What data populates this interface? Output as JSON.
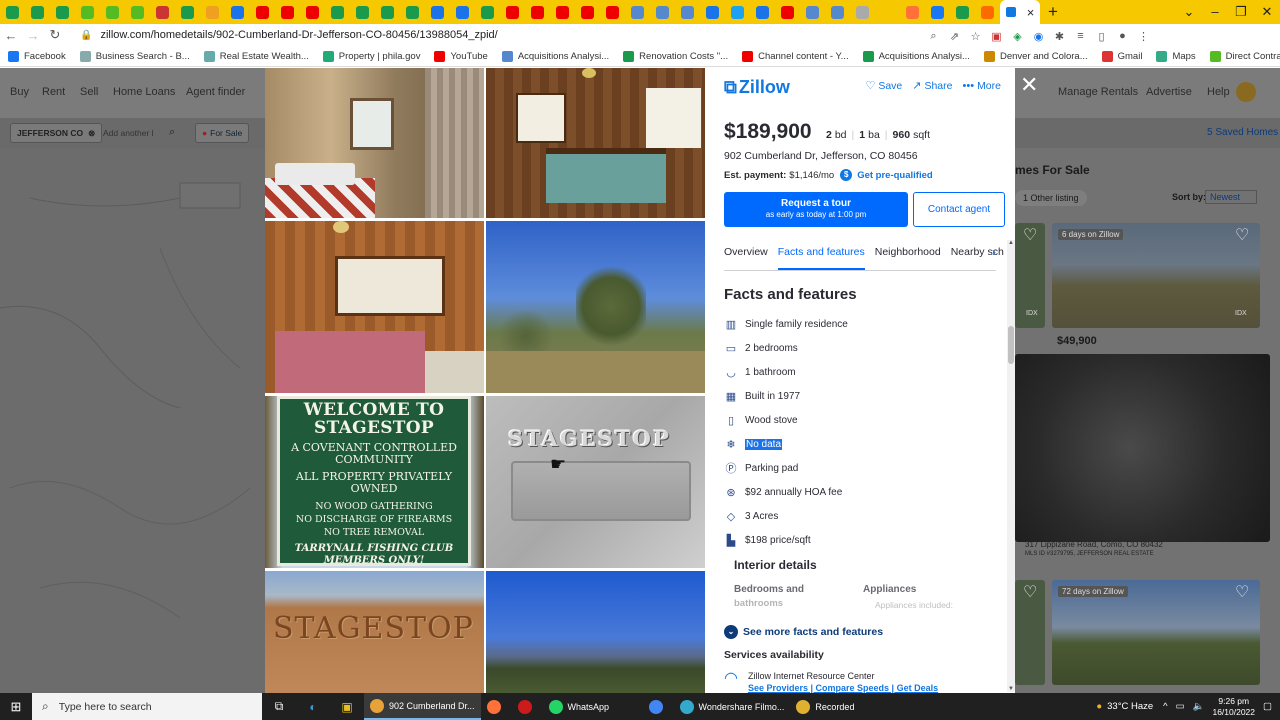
{
  "browser": {
    "url": "zillow.com/homedetails/902-Cumberland-Dr-Jefferson-CO-80456/13988054_zpid/",
    "tab_close": "×",
    "new_tab": "+",
    "bookmarks": [
      {
        "label": "Facebook",
        "color": "#1877f2"
      },
      {
        "label": "Business Search - B...",
        "color": "#8aa"
      },
      {
        "label": "Real Estate Wealth...",
        "color": "#6aa"
      },
      {
        "label": "Property | phila.gov",
        "color": "#2a7"
      },
      {
        "label": "YouTube",
        "color": "#e00"
      },
      {
        "label": "Acquisitions Analysi...",
        "color": "#58c"
      },
      {
        "label": "Renovation Costs \"...",
        "color": "#1a9a4a"
      },
      {
        "label": "Channel content - Y...",
        "color": "#e00"
      },
      {
        "label": "Acquisitions Analysi...",
        "color": "#1a9a4a"
      },
      {
        "label": "Denver and Colora...",
        "color": "#c80"
      },
      {
        "label": "Gmail",
        "color": "#d33"
      },
      {
        "label": "Maps",
        "color": "#3a8"
      },
      {
        "label": "Direct Contracts - U...",
        "color": "#5b2"
      }
    ]
  },
  "background": {
    "nav": [
      "Buy",
      "Rent",
      "Sell",
      "Home Loans",
      "Agent finder",
      "Manage Rentals",
      "Advertise",
      "Help"
    ],
    "search_chip": "JEFFERSON CO",
    "search_placeholder": "Add another l",
    "for_sale_chip": "For Sale",
    "saved_homes": "5 Saved Homes",
    "homes_for_sale": "mes For Sale",
    "other_listing": "1 Other listing",
    "sort_label": "Sort by:",
    "sort_value": "Newest",
    "days_badge_1": "6 days on Zillow",
    "price_card": "$49,900",
    "card_address": "317 Lippizane Road, Como, CO 80432",
    "card_mls": "MLS ID #3279795, JEFFERSON REAL ESTATE",
    "days_badge_2": "72 days on Zillow",
    "idx": "IDX"
  },
  "photos": {
    "sign_line1": "WELCOME TO",
    "sign_line2": "STAGESTOP",
    "sign_line3": "A COVENANT CONTROLLED COMMUNITY",
    "sign_line4": "ALL PROPERTY PRIVATELY OWNED",
    "sign_rule1": "NO WOOD GATHERING",
    "sign_rule2": "NO DISCHARGE OF FIREARMS",
    "sign_rule3": "NO TREE REMOVAL",
    "sign_club": "TARRYNALL FISHING CLUB MEMBERS ONLY!",
    "plaque": "STAGESTOP",
    "wood_sign": "STAGESTOP"
  },
  "listing": {
    "brand": "Zillow",
    "save": "Save",
    "share": "Share",
    "more": "More",
    "price": "$189,900",
    "beds_n": "2",
    "beds_l": "bd",
    "baths_n": "1",
    "baths_l": "ba",
    "sqft_n": "960",
    "sqft_l": "sqft",
    "address": "902 Cumberland Dr, Jefferson, CO 80456",
    "est_payment_label": "Est. payment:",
    "est_payment_value": "$1,146/mo",
    "pre_qualified": "Get pre-qualified",
    "tour_main": "Request a tour",
    "tour_sub": "as early as today at 1:00 pm",
    "contact_agent": "Contact agent",
    "tabs": [
      "Overview",
      "Facts and features",
      "Neighborhood",
      "Nearby sch"
    ],
    "facts_title": "Facts and features",
    "facts": [
      {
        "icon": "building-icon",
        "glyph": "▥",
        "label": "Single family residence"
      },
      {
        "icon": "bed-icon",
        "glyph": "▭",
        "label": "2 bedrooms"
      },
      {
        "icon": "bath-icon",
        "glyph": "◡",
        "label": "1 bathroom"
      },
      {
        "icon": "calendar-icon",
        "glyph": "▦",
        "label": "Built in 1977"
      },
      {
        "icon": "thermometer-icon",
        "glyph": "▯",
        "label": "Wood stove"
      },
      {
        "icon": "snowflake-icon",
        "glyph": "❄",
        "label": "No data"
      },
      {
        "icon": "parking-icon",
        "glyph": "Ⓟ",
        "label": "Parking pad"
      },
      {
        "icon": "hoa-icon",
        "glyph": "⊛",
        "label": "$92 annually HOA fee"
      },
      {
        "icon": "lot-icon",
        "glyph": "◇",
        "label": "3 Acres"
      },
      {
        "icon": "price-sqft-icon",
        "glyph": "▙",
        "label": "$198 price/sqft"
      }
    ],
    "interior_title": "Interior details",
    "bed_bath_head": "Bedrooms and",
    "bed_bath_head2": "bathrooms",
    "appliances_head": "Appliances",
    "appliances_sub": "Appliances included:",
    "see_more": "See more facts and features",
    "services_title": "Services availability",
    "service_name": "Zillow Internet Resource Center",
    "service_links": "See Providers | Compare Speeds | Get Deals"
  },
  "taskbar": {
    "search_placeholder": "Type here to search",
    "apps": [
      {
        "label": "902 Cumberland Dr...",
        "color": "#e8a23a",
        "active": true
      },
      {
        "label": "",
        "color": "#ff7139",
        "active": false
      },
      {
        "label": "",
        "color": "#cc1b1b",
        "active": false
      },
      {
        "label": "WhatsApp",
        "color": "#25d366",
        "active": false
      },
      {
        "label": "",
        "color": "#4285f4",
        "active": false
      },
      {
        "label": "Wondershare Filmo...",
        "color": "#3ac",
        "active": false
      },
      {
        "label": "Recorded",
        "color": "#e0b030",
        "active": false
      }
    ],
    "weather": "33°C  Haze",
    "time": "9:26 pm",
    "date": "16/10/2022"
  }
}
